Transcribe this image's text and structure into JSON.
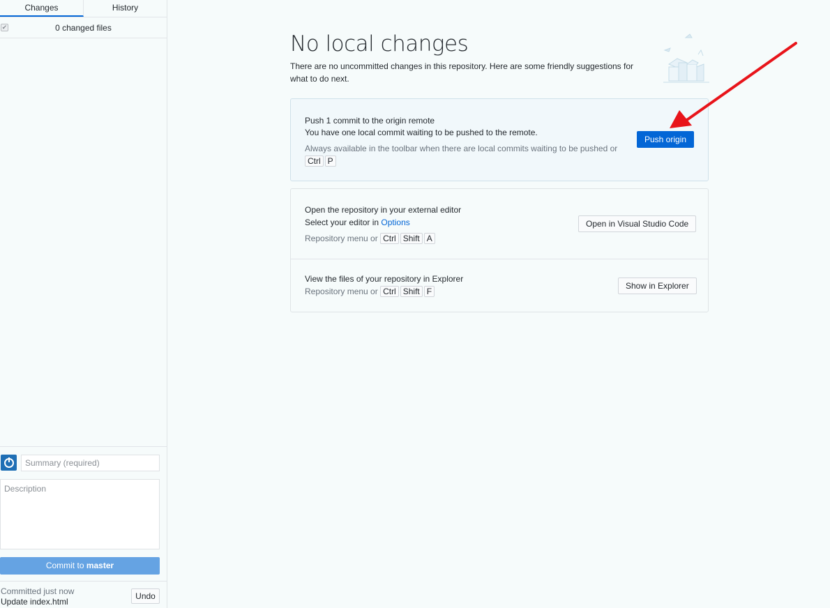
{
  "sidebar": {
    "tabs": [
      {
        "label": "Changes",
        "active": true
      },
      {
        "label": "History",
        "active": false
      }
    ],
    "changed_files": "0 changed files",
    "summary_placeholder": "Summary (required)",
    "description_placeholder": "Description",
    "commit_button_prefix": "Commit to ",
    "commit_button_branch": "master",
    "committed_label": "Committed just now",
    "commit_message": "Update index.html",
    "undo_label": "Undo"
  },
  "main": {
    "title": "No local changes",
    "subtitle": "There are no uncommitted changes in this repository. Here are some friendly suggestions for what to do next.",
    "push": {
      "title": "Push 1 commit to the origin remote",
      "description": "You have one local commit waiting to be pushed to the remote.",
      "hint": "Always available in the toolbar when there are local commits waiting to be pushed or",
      "keys": [
        "Ctrl",
        "P"
      ],
      "button": "Push origin"
    },
    "editor": {
      "title": "Open the repository in your external editor",
      "select_prefix": "Select your editor in ",
      "options_link": "Options",
      "hint": "Repository menu or",
      "keys": [
        "Ctrl",
        "Shift",
        "A"
      ],
      "button": "Open in Visual Studio Code"
    },
    "explorer": {
      "title": "View the files of your repository in Explorer",
      "hint": "Repository menu or",
      "keys": [
        "Ctrl",
        "Shift",
        "F"
      ],
      "button": "Show in Explorer"
    }
  },
  "colors": {
    "accent": "#0366d6",
    "commit_button": "#65a3e3",
    "annotation_arrow": "#e8141a"
  },
  "icons": [
    "checkbox-icon",
    "github-desktop-avatar-icon",
    "empty-repo-illustration",
    "annotation-arrow"
  ]
}
